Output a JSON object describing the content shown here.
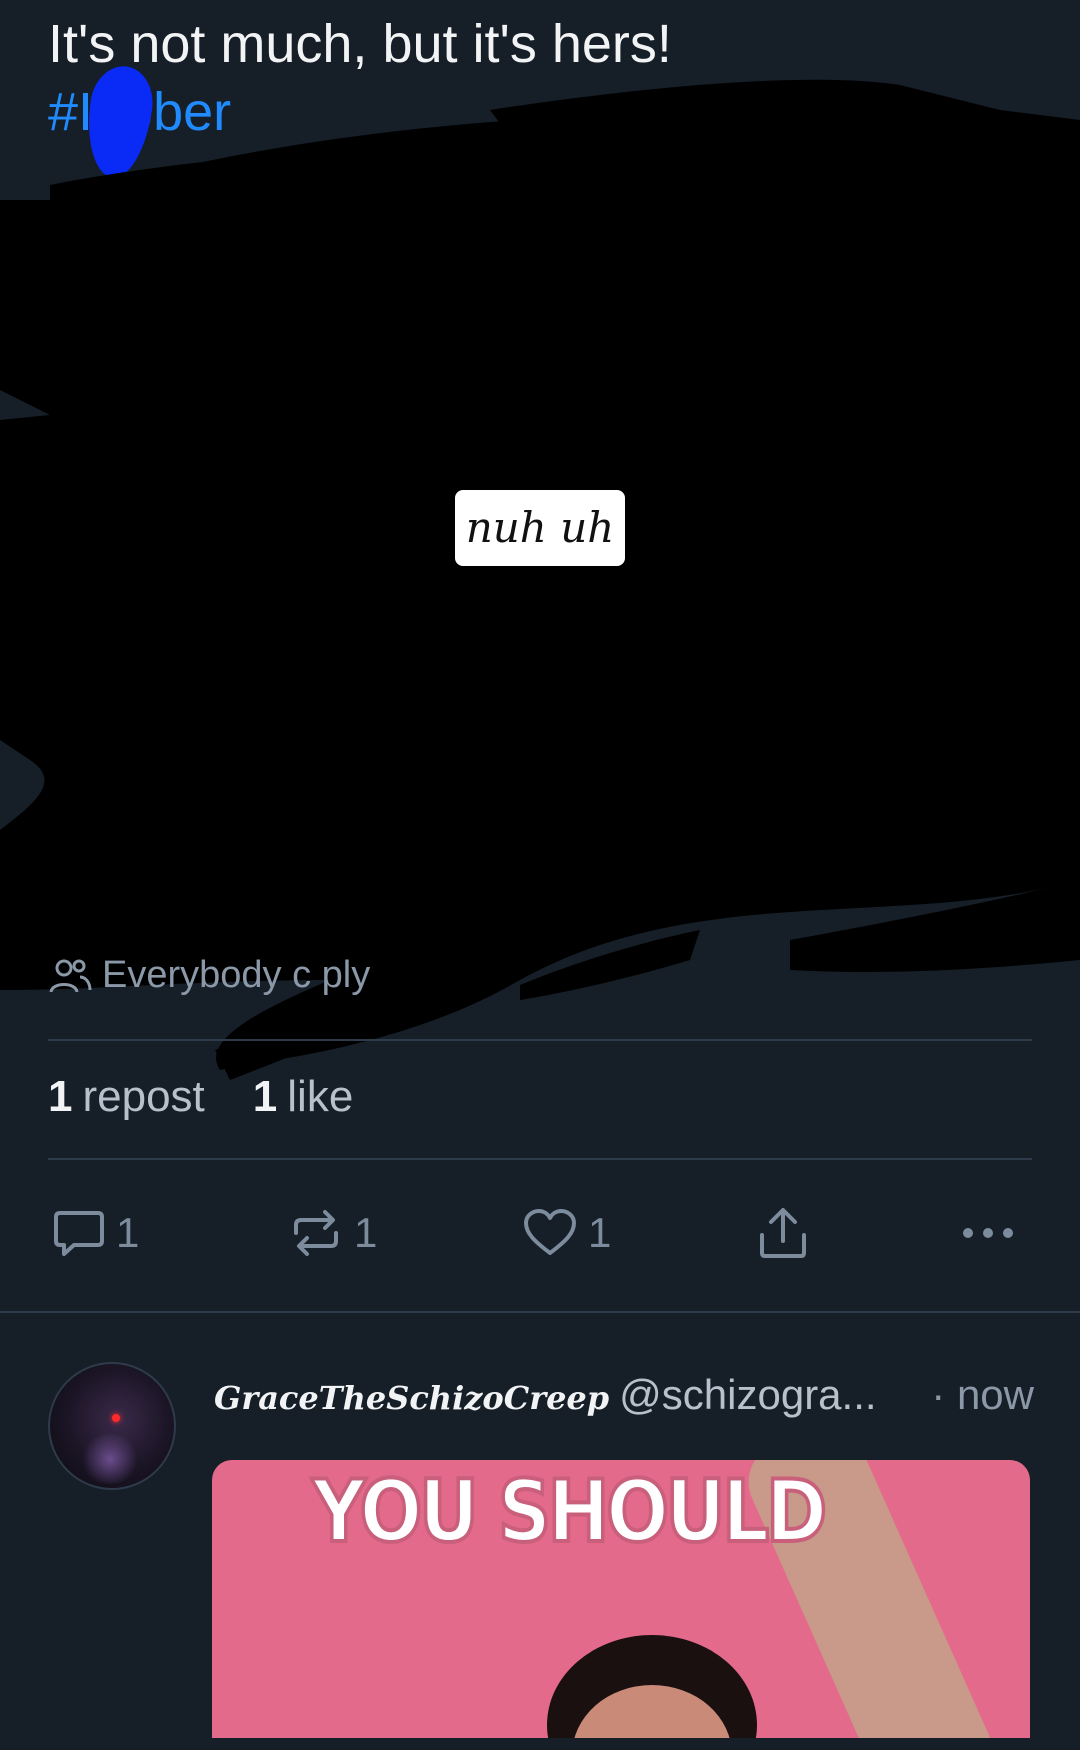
{
  "post": {
    "text": "It's not much, but it's hers!",
    "hashtag": "#I  tober",
    "redaction_label": "nuh uh",
    "reply_setting": "Everybody c    ply",
    "stats": {
      "repost_count": "1",
      "repost_label": "repost",
      "like_count": "1",
      "like_label": "like"
    },
    "actions": {
      "reply_count": "1",
      "repost_count": "1",
      "like_count": "1"
    }
  },
  "next_post": {
    "author_name": "GraceTheSchizoCreep",
    "handle": "@schizogra...",
    "time": "· now",
    "media_text": "YOU SHOULD"
  },
  "icons": {
    "reply_setting": "people-icon",
    "reply": "speech-bubble-icon",
    "repost": "repost-arrows-icon",
    "like": "heart-icon",
    "share": "share-upload-icon",
    "more": "ellipsis-icon"
  },
  "colors": {
    "background": "#161e27",
    "text": "#f1f3f5",
    "link": "#208bfe",
    "muted": "#8a98a8",
    "divider": "#2e3b4a"
  }
}
